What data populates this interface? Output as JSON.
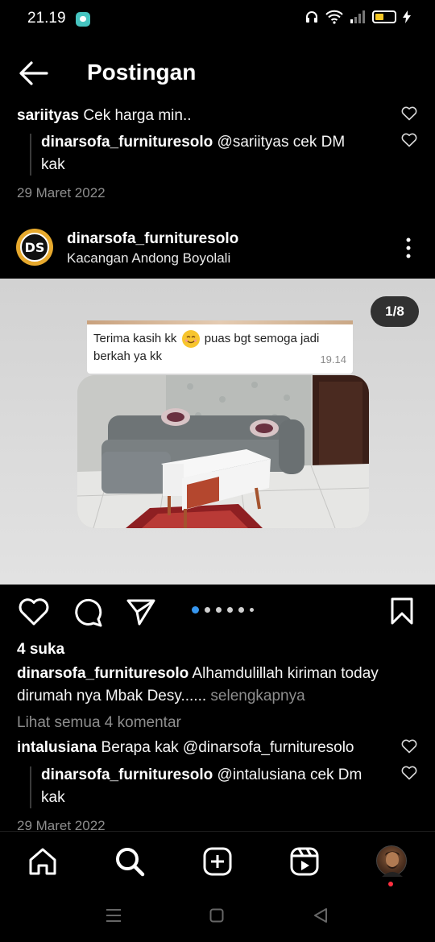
{
  "status_bar": {
    "time": "21.19"
  },
  "header": {
    "title": "Postingan",
    "back_icon": "arrow-left-icon"
  },
  "top_comments": {
    "comment": {
      "user": "sariityas",
      "text": "Cek harga min.."
    },
    "reply": {
      "user": "dinarsofa_furnituresolo",
      "text": "@sariityas cek DM",
      "text_line2": "kak"
    },
    "date": "29 Maret 2022"
  },
  "post": {
    "avatar_text": "DS",
    "username": "dinarsofa_furnituresolo",
    "location": "Kacangan Andong Boyolali",
    "counter": "1/8",
    "image": {
      "chat_line1": "Terima kasih kk",
      "chat_line1b": "puas bgt semoga jadi",
      "chat_line2": "berkah ya kk",
      "chat_time": "19.14"
    },
    "likes": "4 suka",
    "caption": {
      "user": "dinarsofa_furnituresolo",
      "text": "Alhamdulillah kiriman today",
      "text_line2": "dirumah nya Mbak Desy......",
      "more": "selengkapnya"
    },
    "view_comments": "Lihat semua 4 komentar",
    "comment": {
      "user": "intalusiana",
      "text": "Berapa kak @dinarsofa_furnituresolo"
    },
    "reply": {
      "user": "dinarsofa_furnituresolo",
      "text": "@intalusiana cek Dm",
      "text_line2": "kak"
    },
    "date": "29 Maret 2022"
  },
  "colors": {
    "background": "#000000",
    "active_dot": "#3797f0",
    "muted_text": "#8e8e8e",
    "notification": "#ff3040"
  }
}
